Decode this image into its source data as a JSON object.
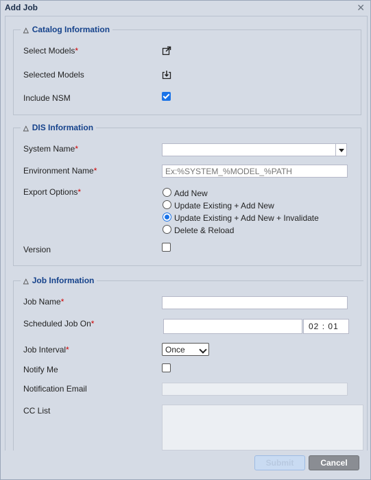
{
  "dialog": {
    "title": "Add Job",
    "close_glyph": "✕"
  },
  "catalog": {
    "legend": "Catalog Information",
    "select_models_label": "Select Models",
    "selected_models_label": "Selected Models",
    "include_nsm_label": "Include NSM",
    "include_nsm_checked": true
  },
  "dis": {
    "legend": "DIS Information",
    "system_name_label": "System Name",
    "system_name_value": "",
    "environment_name_label": "Environment Name",
    "environment_name_placeholder": "Ex:%SYSTEM_%MODEL_%PATH",
    "export_options_label": "Export Options",
    "export_options": [
      {
        "label": "Add New",
        "selected": false
      },
      {
        "label": "Update Existing + Add New",
        "selected": false
      },
      {
        "label": "Update Existing + Add New + Invalidate",
        "selected": true
      },
      {
        "label": "Delete & Reload",
        "selected": false
      }
    ],
    "version_label": "Version",
    "version_checked": false
  },
  "job": {
    "legend": "Job Information",
    "job_name_label": "Job Name",
    "scheduled_label": "Scheduled Job On",
    "time_hour": "02",
    "time_sep": ":",
    "time_minute": "01",
    "interval_label": "Job Interval",
    "interval_value": "Once",
    "notify_label": "Notify Me",
    "notify_checked": false,
    "notification_email_label": "Notification Email",
    "cc_list_label": "CC List"
  },
  "required_marker": "*",
  "footer": {
    "submit_label": "Submit",
    "cancel_label": "Cancel"
  },
  "icons": {
    "select_models": "external-link-icon",
    "selected_models": "download-icon",
    "collapse": "triangle-up-icon"
  }
}
